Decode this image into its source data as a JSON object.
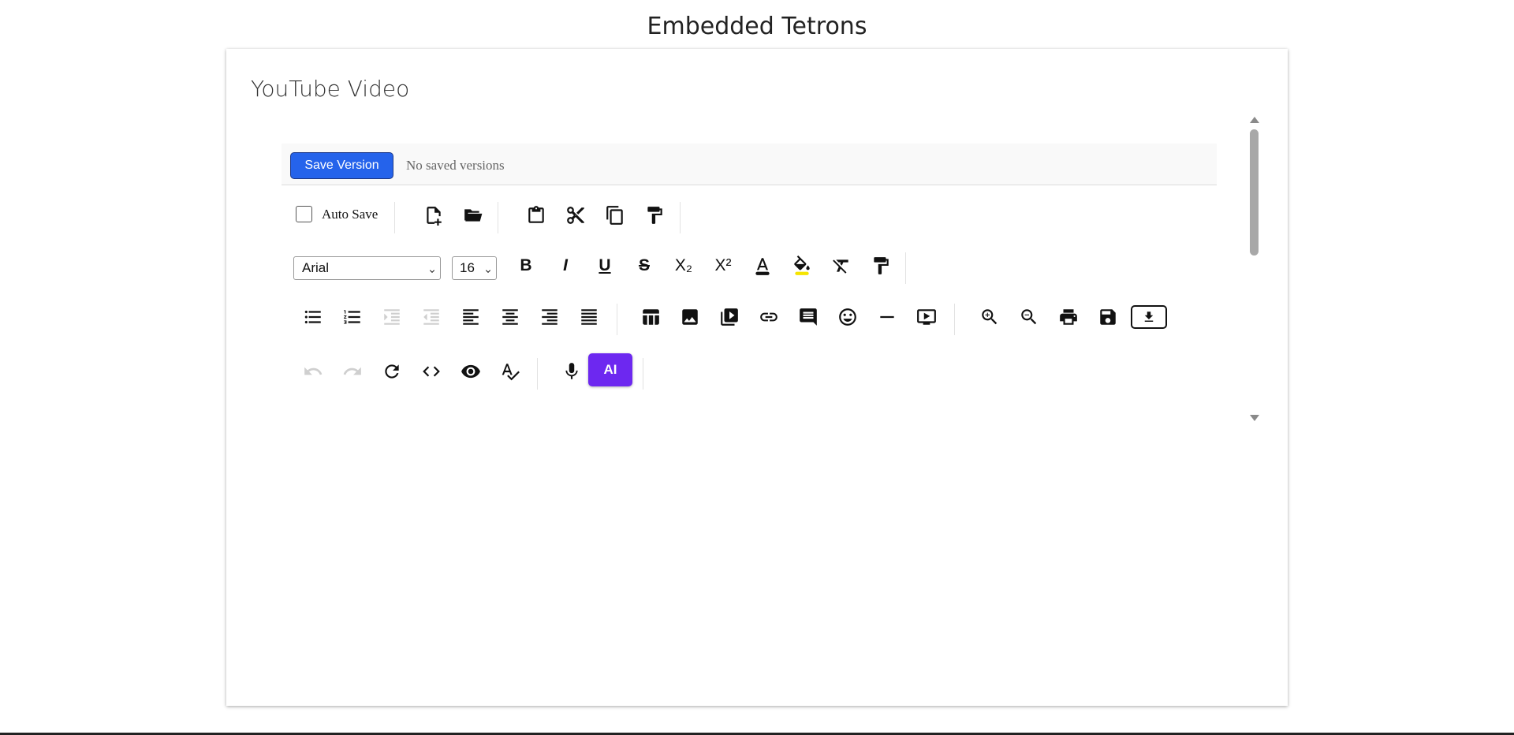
{
  "page": {
    "title": "Embedded Tetrons"
  },
  "card": {
    "title": "YouTube Video"
  },
  "versions": {
    "save_label": "Save Version",
    "status": "No saved versions"
  },
  "toolbar": {
    "autosave_label": "Auto Save",
    "font_family": "Arial",
    "font_size": "16",
    "ai_label": "AI",
    "bold_label": "B",
    "italic_label": "I",
    "underline_label": "U",
    "strike_label": "S",
    "subscript_label": "X₂",
    "superscript_label": "X²",
    "text_color_label": "A"
  },
  "colors": {
    "accent": "#2563eb",
    "ai": "#6d28f0",
    "text_color_bar": "#111111",
    "highlight_bar": "#f5e400"
  }
}
